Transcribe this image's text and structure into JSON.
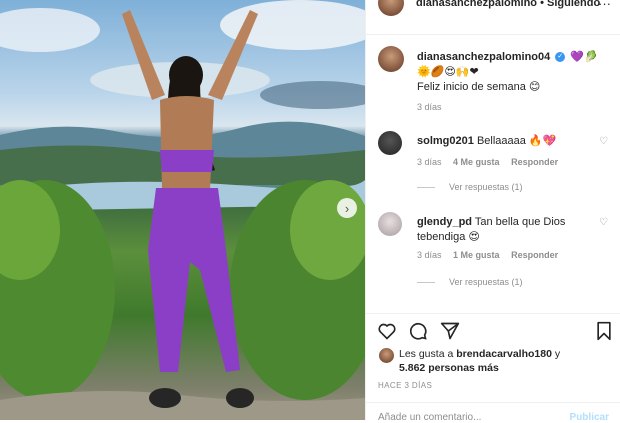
{
  "post": {
    "image_description_icon": "photo-woman-purple-outfit",
    "next_icon": "chevron-right-icon"
  },
  "header": {
    "username": "dianasanchezpalomino",
    "follow_status": "• Siguiendo",
    "more_icon": "more-icon"
  },
  "caption": {
    "username": "dianasanchezpalomino04",
    "emojis_line1": "💜🥬",
    "emojis_line2": "🌞🏉😍🙌❤",
    "text": "Feliz inicio de semana 😊",
    "time": "3 días"
  },
  "comments": [
    {
      "username": "solmg0201",
      "text": "Bellaaaaa 🔥💖",
      "time": "3 días",
      "likes": "4 Me gusta",
      "reply": "Responder",
      "view_replies": "Ver respuestas (1)"
    },
    {
      "username": "glendy_pd",
      "text": "Tan bella que Dios tebendiga 😍",
      "time": "3 días",
      "likes": "1 Me gusta",
      "reply": "Responder",
      "view_replies": "Ver respuestas (1)"
    }
  ],
  "likes": {
    "prefix": "Les gusta a",
    "user": "brendacarvalho180",
    "connector": "y",
    "count": "5.862 personas más"
  },
  "posted": "HACE 3 DÍAS",
  "add_comment": {
    "placeholder": "Añade un comentario...",
    "publish": "Publicar"
  },
  "colors": {
    "accent": "#3897f0",
    "outfit": "#8b3fc7",
    "meta": "#8e8e8e"
  }
}
